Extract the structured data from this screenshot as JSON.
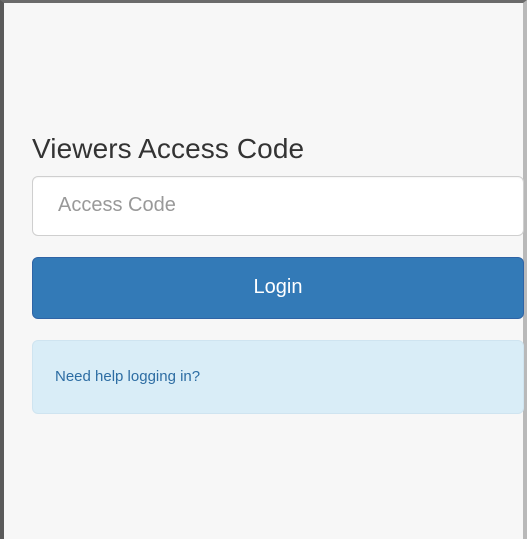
{
  "login": {
    "title": "Viewers Access Code",
    "access_code": {
      "placeholder": "Access Code",
      "value": ""
    },
    "login_button": "Login",
    "help_link": "Need help logging in?"
  }
}
